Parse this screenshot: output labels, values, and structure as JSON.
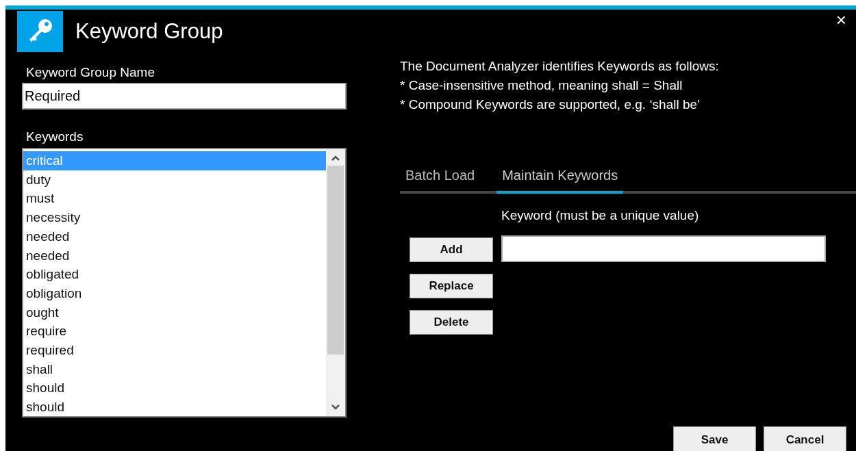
{
  "window": {
    "title": "Keyword Group",
    "close": "×"
  },
  "group_name": {
    "label": "Keyword Group Name",
    "value": "Required"
  },
  "keywords": {
    "label": "Keywords",
    "items": [
      {
        "text": "critical",
        "selected": true
      },
      {
        "text": "duty",
        "selected": false
      },
      {
        "text": "must",
        "selected": false
      },
      {
        "text": "necessity",
        "selected": false
      },
      {
        "text": "needed",
        "selected": false
      },
      {
        "text": "needed",
        "selected": false
      },
      {
        "text": "obligated",
        "selected": false
      },
      {
        "text": "obligation",
        "selected": false
      },
      {
        "text": "ought",
        "selected": false
      },
      {
        "text": "require",
        "selected": false
      },
      {
        "text": "required",
        "selected": false
      },
      {
        "text": "shall",
        "selected": false
      },
      {
        "text": "should",
        "selected": false
      },
      {
        "text": "should",
        "selected": false
      }
    ]
  },
  "info": [
    "The Document Analyzer identifies Keywords as follows:",
    "* Case-insensitive method, meaning shall = Shall",
    "* Compound Keywords are supported, e.g. ‘shall be’"
  ],
  "tabs": [
    {
      "label": "Batch Load",
      "selected": false
    },
    {
      "label": "Maintain Keywords",
      "selected": true
    }
  ],
  "keyword_field": {
    "label": "Keyword (must be a unique value)"
  },
  "actions": [
    "Add",
    "Replace",
    "Delete"
  ],
  "footer_buttons": [
    "Save",
    "Cancel"
  ]
}
